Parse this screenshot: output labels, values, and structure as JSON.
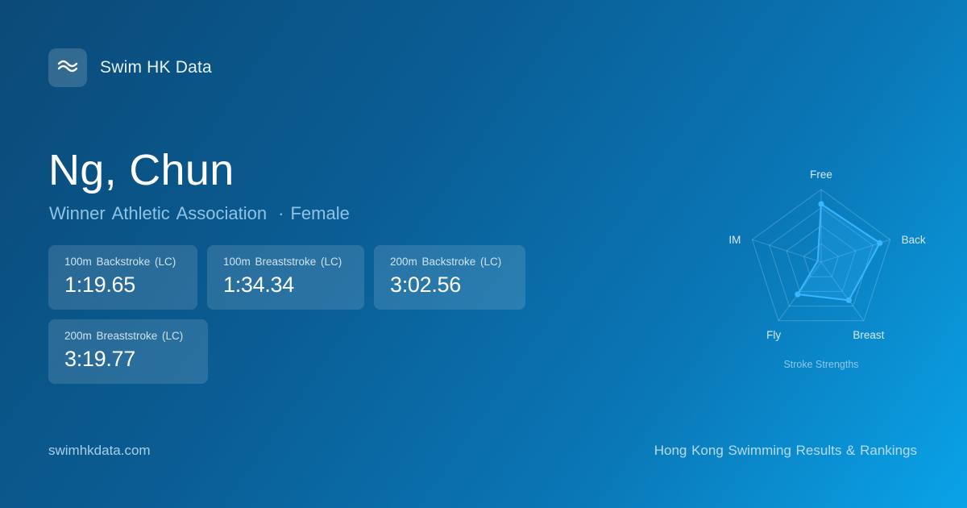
{
  "brand": {
    "name": "Swim HK Data",
    "logo_icon": "wave-icon"
  },
  "swimmer": {
    "name": "Ng, Chun",
    "club": "Winner Athletic Association",
    "separator": "·",
    "gender": "Female"
  },
  "results": [
    {
      "event": "100m Backstroke (LC)",
      "time": "1:19.65"
    },
    {
      "event": "100m Breaststroke (LC)",
      "time": "1:34.34"
    },
    {
      "event": "200m Backstroke (LC)",
      "time": "3:02.56"
    },
    {
      "event": "200m Breaststroke (LC)",
      "time": "3:19.77"
    }
  ],
  "radar": {
    "caption": "Stroke Strengths",
    "axes": [
      "Free",
      "Back",
      "Breast",
      "Fly",
      "IM"
    ],
    "values": [
      0.8,
      0.85,
      0.65,
      0.55,
      0.05
    ],
    "grid_levels": 4,
    "colors": {
      "line": "#38b6ff",
      "fill": "rgba(56,182,255,0.22)",
      "grid": "rgba(190,225,250,0.28)"
    }
  },
  "footer": {
    "site": "swimhkdata.com",
    "tagline": "Hong Kong Swimming Results & Rankings"
  }
}
